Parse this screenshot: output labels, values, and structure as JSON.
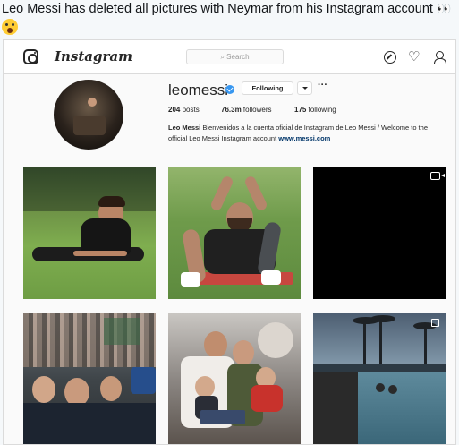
{
  "tweet": {
    "text": "Leo Messi has deleted all pictures with Neymar from his Instagram account",
    "emoji_eyes": "👀",
    "emoji_scream": "scream-emoji"
  },
  "instagram": {
    "wordmark": "Instagram",
    "search_placeholder": "Search",
    "nav_icons": [
      "instagram-glyph-icon",
      "compass-icon",
      "heart-icon",
      "profile-icon"
    ],
    "profile": {
      "username": "leomessi",
      "following_label": "Following",
      "more_label": "···",
      "posts_count": "204",
      "posts_label": "posts",
      "followers_count": "76.3m",
      "followers_label": "followers",
      "following_count": "175",
      "following_stat_label": "following",
      "bio_name": "Leo Messi",
      "bio_text": "Bienvenidos a la cuenta oficial de Instagram de Leo Messi / Welcome to the official Leo Messi Instagram account",
      "bio_link": "www.messi.com"
    },
    "posts": [
      {
        "name": "post-messi-lying-grass",
        "type": "photo"
      },
      {
        "name": "post-messi-sitting-stretch",
        "type": "photo"
      },
      {
        "name": "post-black-video",
        "type": "video"
      },
      {
        "name": "post-crowd-fans",
        "type": "photo"
      },
      {
        "name": "post-family-jet",
        "type": "photo"
      },
      {
        "name": "post-pool-sunset",
        "type": "album"
      }
    ]
  },
  "colors": {
    "verified": "#3897f0",
    "link": "#003569",
    "text": "#262626",
    "border": "#dbdbdb"
  }
}
